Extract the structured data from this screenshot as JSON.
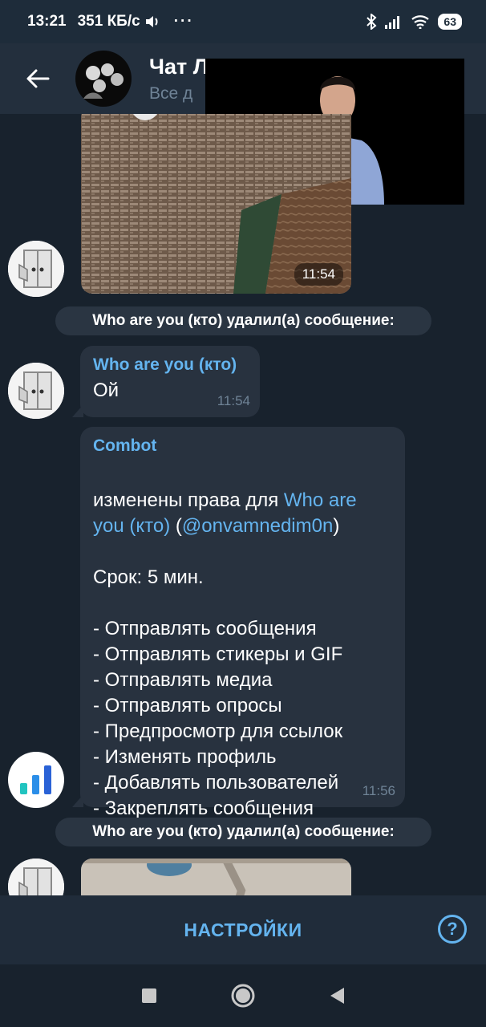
{
  "status_bar": {
    "time": "13:21",
    "speed": "351 КБ/с",
    "dots": "···",
    "battery": "63"
  },
  "header": {
    "title": "Чат Лидер ТВ",
    "subtitle": "Все д"
  },
  "messages": {
    "photo_top_time": "11:54",
    "service_1": "Who are you (кто) удалил(а) сообщение:",
    "msg1": {
      "sender": "Who are you (кто)",
      "text": "Ой",
      "time": "11:54"
    },
    "msg2": {
      "sender": "Combot",
      "line1_prefix": "изменены права для ",
      "line1_link": "Who are you (кто)",
      "line1_open": " (",
      "line1_mention": "@onvamnedim0n",
      "line1_close": ")",
      "body": "\nСрок: 5 мин.\n\n- Отправлять сообщения\n- Отправлять стикеры и GIF\n- Отправлять медиа\n- Отправлять опросы\n- Предпросмотр для ссылок\n- Изменять профиль\n- Добавлять пользователей\n- Закреплять сообщения",
      "time": "11:56"
    },
    "service_2": "Who are you (кто) удалил(а) сообщение:"
  },
  "action_bar": {
    "settings_label": "НАСТРОЙКИ",
    "help_label": "?"
  },
  "colors": {
    "background": "#18222d",
    "bubble": "#28323f",
    "accent": "#64b4ef",
    "muted": "#6f8396"
  },
  "icons": [
    "back-arrow-icon",
    "verified-badge-icon",
    "more-icon",
    "bot-chart-icon",
    "help-icon",
    "nav-recents-icon",
    "nav-home-icon",
    "nav-back-icon"
  ]
}
